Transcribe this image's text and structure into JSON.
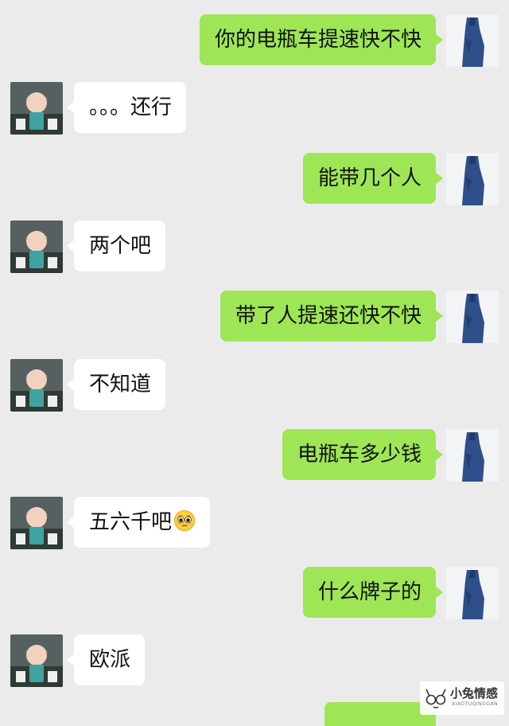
{
  "chat": {
    "messages": [
      {
        "side": "out",
        "text": "你的电瓶车提速快不快"
      },
      {
        "side": "in",
        "text": "。。。还行"
      },
      {
        "side": "out",
        "text": "能带几个人"
      },
      {
        "side": "in",
        "text": "两个吧"
      },
      {
        "side": "out",
        "text": "带了人提速还快不快"
      },
      {
        "side": "in",
        "text": "不知道"
      },
      {
        "side": "out",
        "text": "电瓶车多少钱"
      },
      {
        "side": "in",
        "text": "五六千吧",
        "emoji": "pleading-face-emoji"
      },
      {
        "side": "out",
        "text": "什么牌子的"
      },
      {
        "side": "in",
        "text": "欧派"
      }
    ]
  },
  "colors": {
    "background": "#ebebeb",
    "outgoing_bubble": "#9ee655",
    "incoming_bubble": "#ffffff"
  },
  "watermark": {
    "title": "小兔情感",
    "subtitle": "XIAOTUQINGGAN"
  }
}
